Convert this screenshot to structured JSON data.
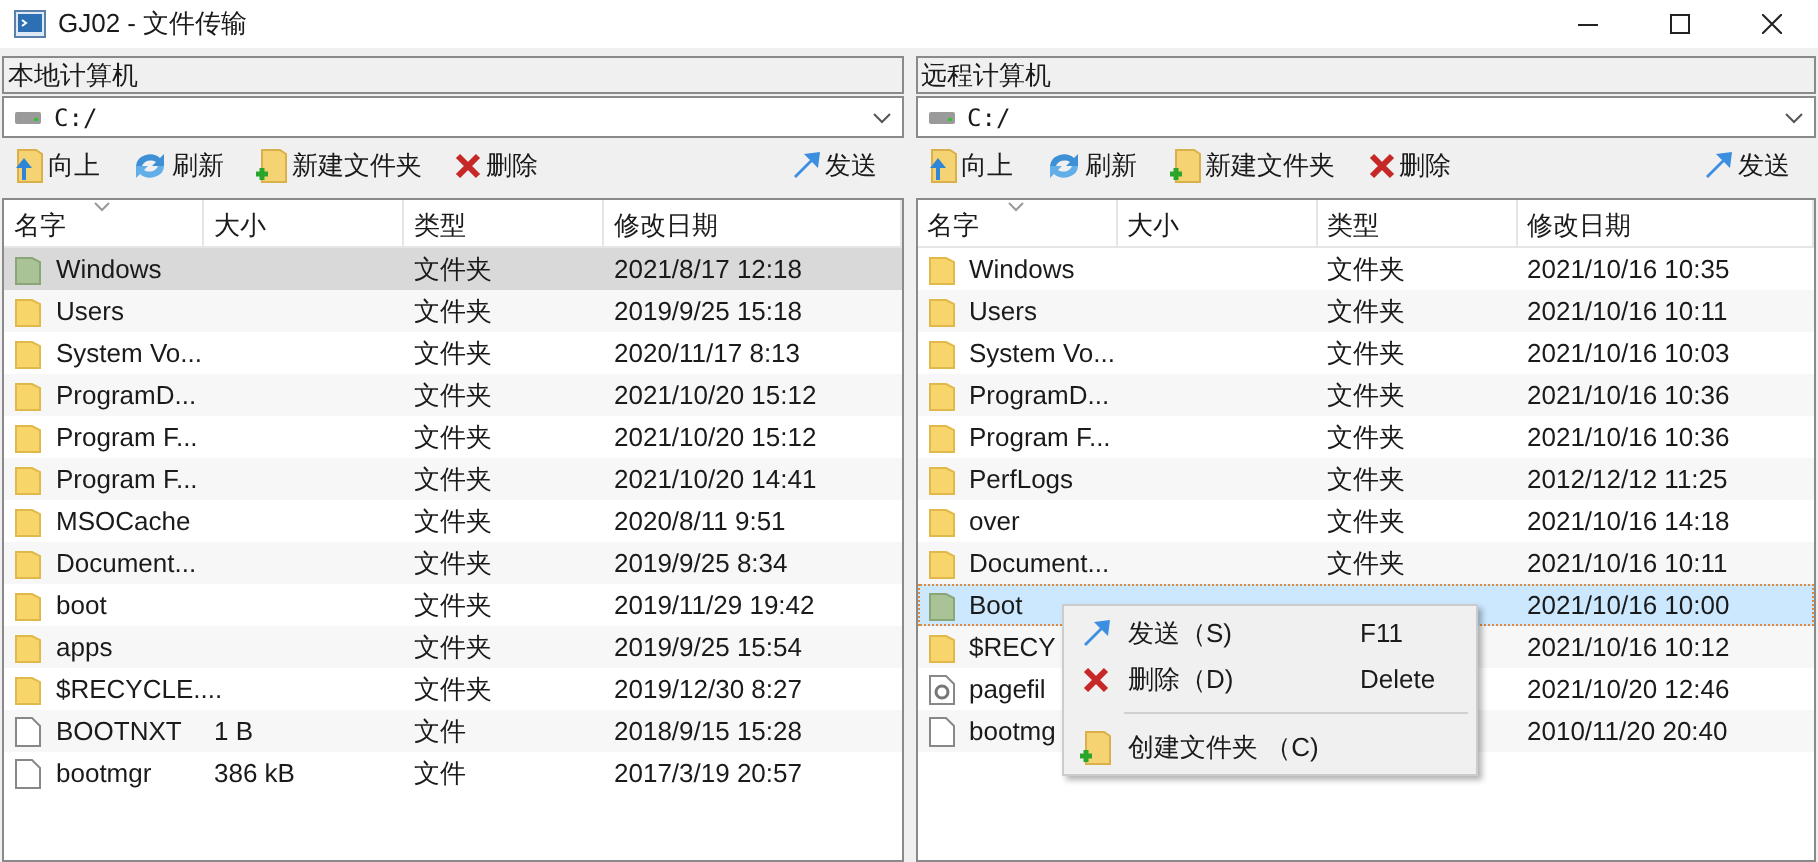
{
  "window": {
    "title": "GJ02 - 文件传输"
  },
  "panes": [
    {
      "title": "本地计算机",
      "path": "C:/",
      "toolbar": [
        {
          "kind": "up",
          "label": "向上"
        },
        {
          "kind": "refresh",
          "label": "刷新"
        },
        {
          "kind": "new-folder",
          "label": "新建文件夹"
        },
        {
          "kind": "delete",
          "label": "删除"
        },
        {
          "kind": "send",
          "label": "发送"
        }
      ],
      "columns": [
        "名字",
        "大小",
        "类型",
        "修改日期"
      ],
      "rows": [
        {
          "kind": "folder",
          "name": "Windows",
          "type": "文件夹",
          "modified": "2021/8/17 12:18",
          "selected": true
        },
        {
          "kind": "folder",
          "name": "Users",
          "type": "文件夹",
          "modified": "2019/9/25 15:18",
          "selected": false
        },
        {
          "kind": "folder",
          "name": "System Vo...",
          "type": "文件夹",
          "modified": "2020/11/17 8:13",
          "selected": false
        },
        {
          "kind": "folder",
          "name": "ProgramD...",
          "type": "文件夹",
          "modified": "2021/10/20 15:12",
          "selected": false
        },
        {
          "kind": "folder",
          "name": "Program F...",
          "type": "文件夹",
          "modified": "2021/10/20 15:12",
          "selected": false
        },
        {
          "kind": "folder",
          "name": "Program F...",
          "type": "文件夹",
          "modified": "2021/10/20 14:41",
          "selected": false
        },
        {
          "kind": "folder",
          "name": "MSOCache",
          "type": "文件夹",
          "modified": "2020/8/11 9:51",
          "selected": false
        },
        {
          "kind": "folder",
          "name": "Document...",
          "type": "文件夹",
          "modified": "2019/9/25 8:34",
          "selected": false
        },
        {
          "kind": "folder",
          "name": "boot",
          "type": "文件夹",
          "modified": "2019/11/29 19:42",
          "selected": false
        },
        {
          "kind": "folder",
          "name": "apps",
          "type": "文件夹",
          "modified": "2019/9/25 15:54",
          "selected": false
        },
        {
          "kind": "folder",
          "name": "$RECYCLE....",
          "type": "文件夹",
          "modified": "2019/12/30 8:27",
          "selected": false
        },
        {
          "kind": "file",
          "name": "BOOTNXT",
          "size": "1 B",
          "type": "文件",
          "modified": "2018/9/15 15:28",
          "selected": false
        },
        {
          "kind": "file",
          "name": "bootmgr",
          "size": "386 kB",
          "type": "文件",
          "modified": "2017/3/19 20:57",
          "selected": false
        }
      ]
    },
    {
      "title": "远程计算机",
      "path": "C:/",
      "toolbar": [
        {
          "kind": "up",
          "label": "向上"
        },
        {
          "kind": "refresh",
          "label": "刷新"
        },
        {
          "kind": "new-folder",
          "label": "新建文件夹"
        },
        {
          "kind": "delete",
          "label": "删除"
        },
        {
          "kind": "send",
          "label": "发送"
        }
      ],
      "columns": [
        "名字",
        "大小",
        "类型",
        "修改日期"
      ],
      "rows": [
        {
          "kind": "folder",
          "name": "Windows",
          "type": "文件夹",
          "modified": "2021/10/16 10:35",
          "selected": false
        },
        {
          "kind": "folder",
          "name": "Users",
          "type": "文件夹",
          "modified": "2021/10/16 10:11",
          "selected": false
        },
        {
          "kind": "folder",
          "name": "System Vo...",
          "type": "文件夹",
          "modified": "2021/10/16 10:03",
          "selected": false
        },
        {
          "kind": "folder",
          "name": "ProgramD...",
          "type": "文件夹",
          "modified": "2021/10/16 10:36",
          "selected": false
        },
        {
          "kind": "folder",
          "name": "Program F...",
          "type": "文件夹",
          "modified": "2021/10/16 10:36",
          "selected": false
        },
        {
          "kind": "folder",
          "name": "PerfLogs",
          "type": "文件夹",
          "modified": "2012/12/12 11:25",
          "selected": false
        },
        {
          "kind": "folder",
          "name": "over",
          "type": "文件夹",
          "modified": "2021/10/16 14:18",
          "selected": false
        },
        {
          "kind": "folder",
          "name": "Document...",
          "type": "文件夹",
          "modified": "2021/10/16 10:11",
          "selected": false
        },
        {
          "kind": "folder",
          "name": "Boot",
          "modified": "2021/10/16 10:00",
          "selected": true
        },
        {
          "kind": "folder",
          "name": "$RECY",
          "modified": "2021/10/16 10:12",
          "selected": false
        },
        {
          "kind": "system-file",
          "name": "pagefil",
          "modified": "2021/10/20 12:46",
          "selected": false
        },
        {
          "kind": "file",
          "name": "bootmg",
          "modified": "2010/11/20 20:40",
          "selected": false
        }
      ]
    }
  ],
  "context_menu": {
    "items": [
      {
        "kind": "send",
        "label": "发送（S)",
        "shortcut": "F11"
      },
      {
        "kind": "delete",
        "label": "删除（D)",
        "shortcut": "Delete"
      },
      {
        "kind": "separator"
      },
      {
        "kind": "new-folder",
        "label": "创建文件夹 （C)"
      }
    ]
  }
}
